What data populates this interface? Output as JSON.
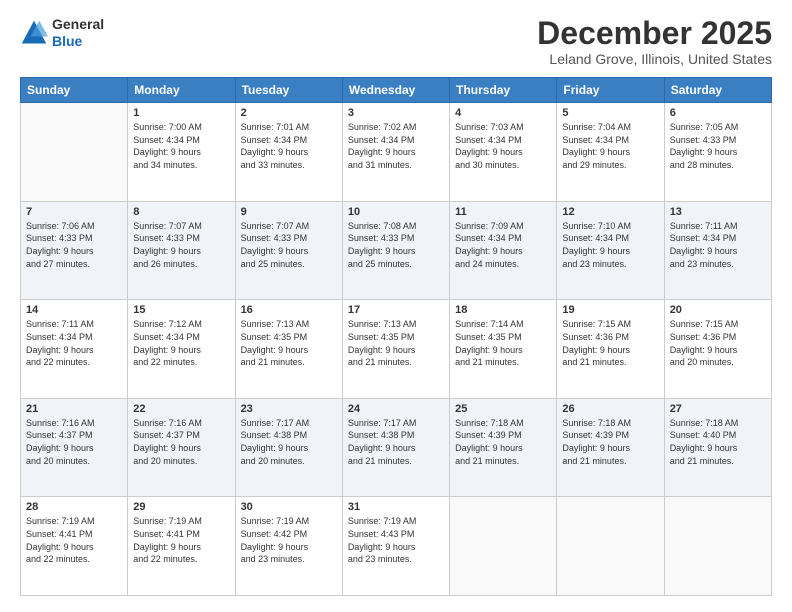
{
  "header": {
    "logo_general": "General",
    "logo_blue": "Blue",
    "month_title": "December 2025",
    "location": "Leland Grove, Illinois, United States"
  },
  "weekdays": [
    "Sunday",
    "Monday",
    "Tuesday",
    "Wednesday",
    "Thursday",
    "Friday",
    "Saturday"
  ],
  "weeks": [
    [
      {
        "day": "",
        "info": ""
      },
      {
        "day": "1",
        "info": "Sunrise: 7:00 AM\nSunset: 4:34 PM\nDaylight: 9 hours\nand 34 minutes."
      },
      {
        "day": "2",
        "info": "Sunrise: 7:01 AM\nSunset: 4:34 PM\nDaylight: 9 hours\nand 33 minutes."
      },
      {
        "day": "3",
        "info": "Sunrise: 7:02 AM\nSunset: 4:34 PM\nDaylight: 9 hours\nand 31 minutes."
      },
      {
        "day": "4",
        "info": "Sunrise: 7:03 AM\nSunset: 4:34 PM\nDaylight: 9 hours\nand 30 minutes."
      },
      {
        "day": "5",
        "info": "Sunrise: 7:04 AM\nSunset: 4:34 PM\nDaylight: 9 hours\nand 29 minutes."
      },
      {
        "day": "6",
        "info": "Sunrise: 7:05 AM\nSunset: 4:33 PM\nDaylight: 9 hours\nand 28 minutes."
      }
    ],
    [
      {
        "day": "7",
        "info": "Sunrise: 7:06 AM\nSunset: 4:33 PM\nDaylight: 9 hours\nand 27 minutes."
      },
      {
        "day": "8",
        "info": "Sunrise: 7:07 AM\nSunset: 4:33 PM\nDaylight: 9 hours\nand 26 minutes."
      },
      {
        "day": "9",
        "info": "Sunrise: 7:07 AM\nSunset: 4:33 PM\nDaylight: 9 hours\nand 25 minutes."
      },
      {
        "day": "10",
        "info": "Sunrise: 7:08 AM\nSunset: 4:33 PM\nDaylight: 9 hours\nand 25 minutes."
      },
      {
        "day": "11",
        "info": "Sunrise: 7:09 AM\nSunset: 4:34 PM\nDaylight: 9 hours\nand 24 minutes."
      },
      {
        "day": "12",
        "info": "Sunrise: 7:10 AM\nSunset: 4:34 PM\nDaylight: 9 hours\nand 23 minutes."
      },
      {
        "day": "13",
        "info": "Sunrise: 7:11 AM\nSunset: 4:34 PM\nDaylight: 9 hours\nand 23 minutes."
      }
    ],
    [
      {
        "day": "14",
        "info": "Sunrise: 7:11 AM\nSunset: 4:34 PM\nDaylight: 9 hours\nand 22 minutes."
      },
      {
        "day": "15",
        "info": "Sunrise: 7:12 AM\nSunset: 4:34 PM\nDaylight: 9 hours\nand 22 minutes."
      },
      {
        "day": "16",
        "info": "Sunrise: 7:13 AM\nSunset: 4:35 PM\nDaylight: 9 hours\nand 21 minutes."
      },
      {
        "day": "17",
        "info": "Sunrise: 7:13 AM\nSunset: 4:35 PM\nDaylight: 9 hours\nand 21 minutes."
      },
      {
        "day": "18",
        "info": "Sunrise: 7:14 AM\nSunset: 4:35 PM\nDaylight: 9 hours\nand 21 minutes."
      },
      {
        "day": "19",
        "info": "Sunrise: 7:15 AM\nSunset: 4:36 PM\nDaylight: 9 hours\nand 21 minutes."
      },
      {
        "day": "20",
        "info": "Sunrise: 7:15 AM\nSunset: 4:36 PM\nDaylight: 9 hours\nand 20 minutes."
      }
    ],
    [
      {
        "day": "21",
        "info": "Sunrise: 7:16 AM\nSunset: 4:37 PM\nDaylight: 9 hours\nand 20 minutes."
      },
      {
        "day": "22",
        "info": "Sunrise: 7:16 AM\nSunset: 4:37 PM\nDaylight: 9 hours\nand 20 minutes."
      },
      {
        "day": "23",
        "info": "Sunrise: 7:17 AM\nSunset: 4:38 PM\nDaylight: 9 hours\nand 20 minutes."
      },
      {
        "day": "24",
        "info": "Sunrise: 7:17 AM\nSunset: 4:38 PM\nDaylight: 9 hours\nand 21 minutes."
      },
      {
        "day": "25",
        "info": "Sunrise: 7:18 AM\nSunset: 4:39 PM\nDaylight: 9 hours\nand 21 minutes."
      },
      {
        "day": "26",
        "info": "Sunrise: 7:18 AM\nSunset: 4:39 PM\nDaylight: 9 hours\nand 21 minutes."
      },
      {
        "day": "27",
        "info": "Sunrise: 7:18 AM\nSunset: 4:40 PM\nDaylight: 9 hours\nand 21 minutes."
      }
    ],
    [
      {
        "day": "28",
        "info": "Sunrise: 7:19 AM\nSunset: 4:41 PM\nDaylight: 9 hours\nand 22 minutes."
      },
      {
        "day": "29",
        "info": "Sunrise: 7:19 AM\nSunset: 4:41 PM\nDaylight: 9 hours\nand 22 minutes."
      },
      {
        "day": "30",
        "info": "Sunrise: 7:19 AM\nSunset: 4:42 PM\nDaylight: 9 hours\nand 23 minutes."
      },
      {
        "day": "31",
        "info": "Sunrise: 7:19 AM\nSunset: 4:43 PM\nDaylight: 9 hours\nand 23 minutes."
      },
      {
        "day": "",
        "info": ""
      },
      {
        "day": "",
        "info": ""
      },
      {
        "day": "",
        "info": ""
      }
    ]
  ]
}
